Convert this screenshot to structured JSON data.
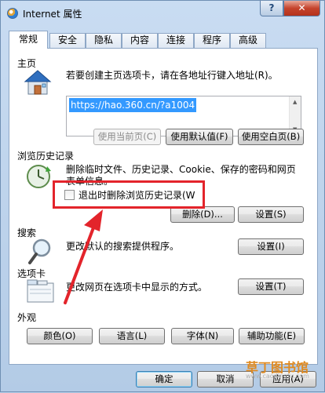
{
  "window": {
    "title": "Internet 属性",
    "help_label": "?",
    "close_label": "✕"
  },
  "tabs": [
    {
      "label": "常规",
      "active": true
    },
    {
      "label": "安全"
    },
    {
      "label": "隐私"
    },
    {
      "label": "内容"
    },
    {
      "label": "连接"
    },
    {
      "label": "程序"
    },
    {
      "label": "高级"
    }
  ],
  "homepage": {
    "group_label": "主页",
    "description": "若要创建主页选项卡，请在各地址行键入地址(R)。",
    "url": "https://hao.360.cn/?a1004",
    "use_current": "使用当前页(C)",
    "use_default": "使用默认值(F)",
    "use_blank": "使用空白页(B)"
  },
  "history": {
    "group_label": "浏览历史记录",
    "description_line1": "删除临时文件、历史记录、Cookie、保存的密码和网页",
    "description_line2": "表单信息。",
    "checkbox_label": "退出时删除浏览历史记录(W",
    "checkbox_checked": false,
    "delete_button": "删除(D)...",
    "settings_button": "设置(S)"
  },
  "search": {
    "group_label": "搜索",
    "description": "更改默认的搜索提供程序。",
    "settings_button": "设置(I)"
  },
  "tabs_section": {
    "group_label": "选项卡",
    "description": "更改网页在选项卡中显示的方式。",
    "settings_button": "设置(T)"
  },
  "appearance": {
    "group_label": "外观",
    "colors": "颜色(O)",
    "languages": "语言(L)",
    "fonts": "字体(N)",
    "accessibility": "辅助功能(E)"
  },
  "footer": {
    "ok": "确定",
    "cancel": "取消",
    "apply": "应用(A)"
  },
  "watermark": {
    "text": "草丁图书馆",
    "url": "www.caodingtu.com"
  },
  "colors": {
    "annotation_red": "#e3242b",
    "selection_blue": "#3399ff"
  }
}
